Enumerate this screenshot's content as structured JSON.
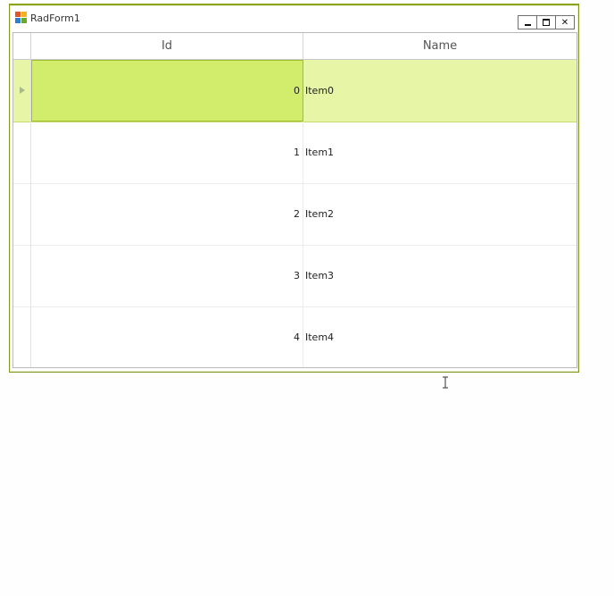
{
  "window": {
    "title": "RadForm1"
  },
  "grid": {
    "columns": [
      "Id",
      "Name"
    ],
    "rows": [
      {
        "id": "0",
        "name": "Item0"
      },
      {
        "id": "1",
        "name": "Item1"
      },
      {
        "id": "2",
        "name": "Item2"
      },
      {
        "id": "3",
        "name": "Item3"
      },
      {
        "id": "4",
        "name": "Item4"
      }
    ],
    "current_row": 0
  },
  "theme": {
    "accent": "#8aa41f",
    "selection": "#e6f5a6",
    "current_cell": "#d2ec6c"
  }
}
